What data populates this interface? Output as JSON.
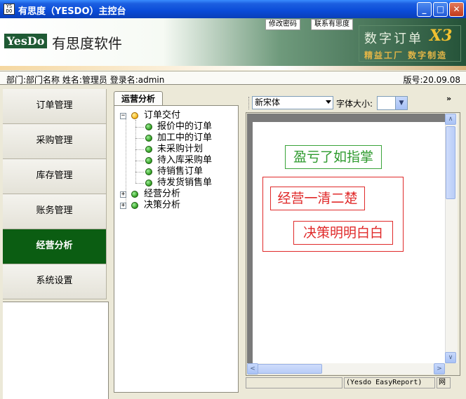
{
  "window": {
    "icon_text": "YS DO",
    "title": "有思度（YESDO）主控台",
    "minimize": "_",
    "maximize": "□",
    "close": "✕"
  },
  "header": {
    "logo": "YesDo",
    "company_name": "有思度软件",
    "links": [
      "修改密码",
      "联系有思度"
    ],
    "product_title": "数字订单",
    "product_version": "X3",
    "slogan": "精益工厂  数字制造"
  },
  "infobar": {
    "user_info": "部门:部门名称  姓名:管理员  登录名:admin",
    "version": "版号:20.09.08"
  },
  "nav": {
    "items": [
      {
        "label": "订单管理",
        "active": false
      },
      {
        "label": "采购管理",
        "active": false
      },
      {
        "label": "库存管理",
        "active": false
      },
      {
        "label": "账务管理",
        "active": false
      },
      {
        "label": "经营分析",
        "active": true
      },
      {
        "label": "系统设置",
        "active": false
      }
    ]
  },
  "tree": {
    "tab_label": "运营分析",
    "root": {
      "label": "订单交付",
      "expander": "−"
    },
    "children": [
      "报价中的订单",
      "加工中的订单",
      "未采购计划",
      "待入库采购单",
      "待销售订单",
      "待发货销售单"
    ],
    "collapsed": [
      {
        "label": "经营分析",
        "expander": "+"
      },
      {
        "label": "决策分析",
        "expander": "+"
      }
    ]
  },
  "toolbar": {
    "font_value": "新宋体",
    "size_label": "字体大小:",
    "size_value": "",
    "more": "»"
  },
  "report": {
    "labels": [
      "盈亏了如指掌",
      "经营一清二楚",
      "决策明明白白"
    ],
    "colors": {
      "green": "#2e9a2e",
      "red": "#e02a2a"
    }
  },
  "statusbar": {
    "cell1": "",
    "cell2": "(Yesdo EasyReport)",
    "cell3": "网"
  },
  "scroll": {
    "up": "∧",
    "down": "∨",
    "left": "<",
    "right": ">"
  }
}
